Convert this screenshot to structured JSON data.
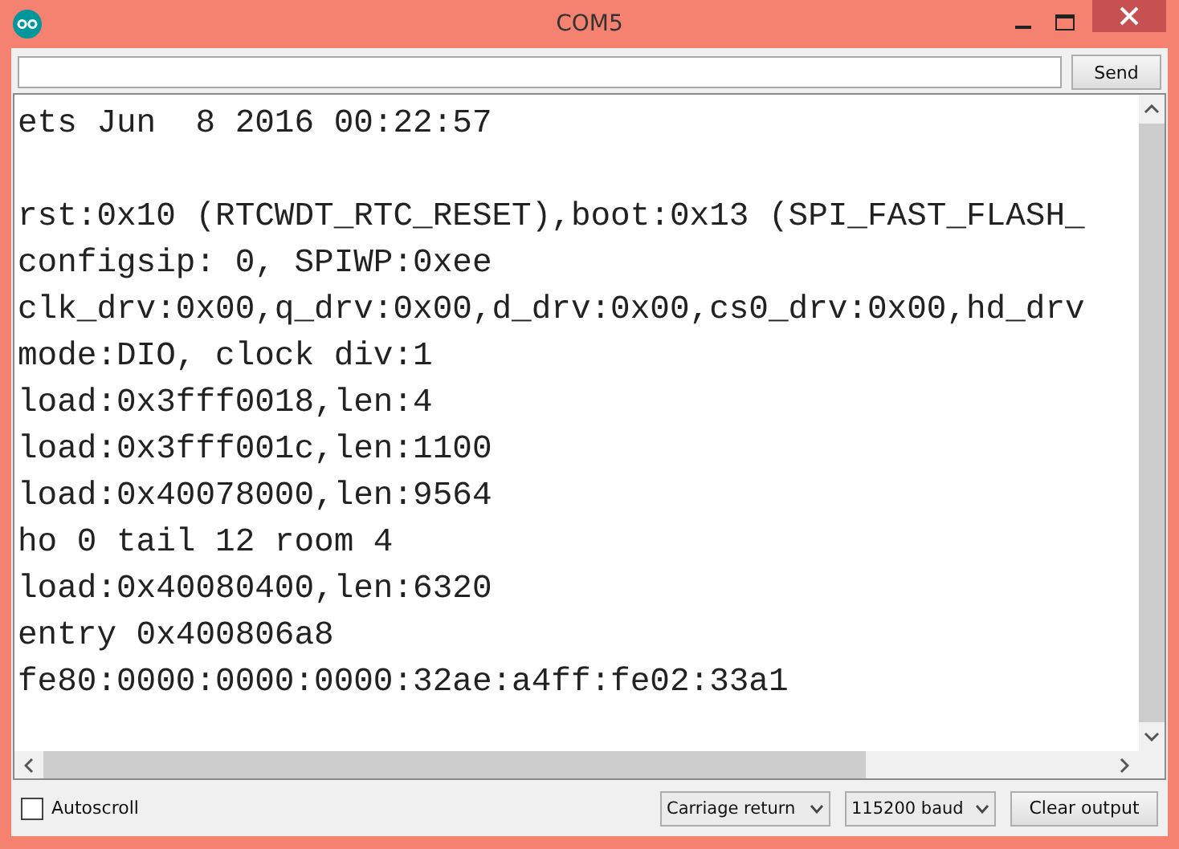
{
  "window": {
    "title": "COM5"
  },
  "send_button": "Send",
  "output": {
    "lines": [
      {
        "kind": "text",
        "text": "ets Jun  8 2016 00:22:57"
      },
      {
        "kind": "blank"
      },
      {
        "kind": "text",
        "text": "rst:0x10 (RTCWDT_RTC_RESET),boot:0x13 (SPI_FAST_FLASH_"
      },
      {
        "kind": "text",
        "text": "configsip: 0, SPIWP:0xee"
      },
      {
        "kind": "text",
        "text": "clk_drv:0x00,q_drv:0x00,d_drv:0x00,cs0_drv:0x00,hd_drv"
      },
      {
        "kind": "text",
        "text": "mode:DIO, clock div:1"
      },
      {
        "kind": "text",
        "text": "load:0x3fff0018,len:4"
      },
      {
        "kind": "text",
        "text": "load:0x3fff001c,len:1100"
      },
      {
        "kind": "text",
        "text": "load:0x40078000,len:9564"
      },
      {
        "kind": "text",
        "text": "ho 0 tail 12 room 4"
      },
      {
        "kind": "text",
        "text": "load:0x40080400,len:6320"
      },
      {
        "kind": "text",
        "text": "entry 0x400806a8"
      },
      {
        "kind": "text",
        "text": "fe80:0000:0000:0000:32ae:a4ff:fe02:33a1"
      }
    ]
  },
  "autoscroll": {
    "label": "Autoscroll",
    "checked": false
  },
  "line_ending": "Carriage return",
  "baud_rate": "115200 baud",
  "clear_button": "Clear output"
}
